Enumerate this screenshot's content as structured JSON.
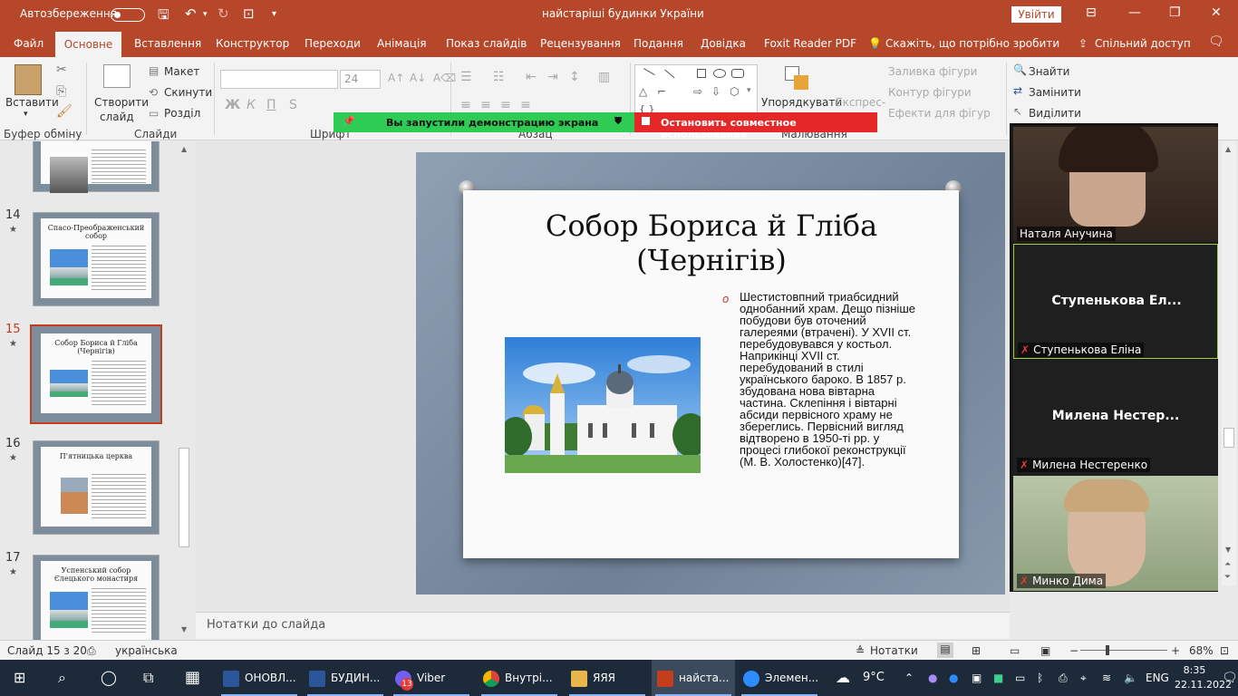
{
  "titlebar": {
    "autosave_label": "Автозбереження",
    "autosave_state": "Off",
    "doc_title": "найстаріші будинки України",
    "signin_label": "Увійти"
  },
  "tabs": [
    "Файл",
    "Основне",
    "Вставлення",
    "Конструктор",
    "Переходи",
    "Анімація",
    "Показ слайдів",
    "Рецензування",
    "Подання",
    "Довідка",
    "Foxit Reader PDF"
  ],
  "tell_me": "Скажіть, що потрібно зробити",
  "share_label": "Спільний доступ",
  "ribbon": {
    "paste": "Вставити",
    "clipboard_group": "Буфер обміну",
    "new_slide_1": "Створити",
    "new_slide_2": "слайд",
    "layout": "Макет",
    "reset": "Скинути",
    "section": "Розділ",
    "slides_group": "Слайди",
    "font_size": "24",
    "font_group": "Шрифт",
    "para_group": "Абзац",
    "arrange": "Упорядкувати",
    "express": "Експрес-",
    "shape_fill": "Заливка фігури",
    "shape_outline": "Контур фігури",
    "shape_effects": "Ефекти для фігур",
    "drawing_group": "Малювання",
    "find": "Знайти",
    "replace": "Замінити",
    "select": "Виділити",
    "bold": "Ж",
    "italic": "К",
    "underline": "П",
    "strike": "S"
  },
  "share_banner": {
    "demo_text": "Вы запустили демонстрацию экрана",
    "stop_text": "Остановить совместное использование"
  },
  "thumbnails": [
    {
      "num": "",
      "title": ""
    },
    {
      "num": "14",
      "title": "Спасо-Преображенський собор"
    },
    {
      "num": "15",
      "title": "Собор Бориса й Гліба (Чернігів)"
    },
    {
      "num": "16",
      "title": "П'ятницька церква"
    },
    {
      "num": "17",
      "title": "Успенський собор Єлецького монастиря"
    }
  ],
  "slide": {
    "title": "Собор Бориса й Гліба (Чернігів)",
    "body": "Шестистовпний триабсидний однобанний храм. Дещо пізніше побудови був оточений галереями (втрачені). У XVII ст. перебудовувався у костьол. Наприкінці XVII ст. перебудований в стилі українського бароко. В 1857 р. збудована нова вівтарна частина. Склепіння і вівтарні абсиди первісного храму не збереглись. Первісний вигляд відтворено в 1950-ті рр. у процесі глибокої реконструкції (М. В. Холостенко)[47]."
  },
  "notes_placeholder": "Нотатки до слайда",
  "participants": [
    {
      "name": "Наталя Анучина",
      "video": true,
      "muted": false
    },
    {
      "name": "Ступенькова Еліна",
      "big": "Ступенькова  Ел...",
      "video": false,
      "muted": true
    },
    {
      "name": "Милена Нестеренко",
      "big": "Милена  Нестер...",
      "video": false,
      "muted": true
    },
    {
      "name": "Минко Дима",
      "video": true,
      "muted": true
    }
  ],
  "status": {
    "slide_counter": "Слайд 15 з 20",
    "language": "українська",
    "notes_btn": "Нотатки",
    "zoom": "68%"
  },
  "taskbar": {
    "apps": [
      {
        "label": "ОНОВЛ...",
        "color": "#2b579a"
      },
      {
        "label": "БУДИН...",
        "color": "#2b579a"
      },
      {
        "label": "Viber",
        "color": "#7360f2",
        "badge": "13"
      },
      {
        "label": "Внутрі...",
        "color": "#dd4b39"
      },
      {
        "label": "ЯЯЯ",
        "color": "#e8b64a"
      },
      {
        "label": "найста...",
        "color": "#c43e1c"
      },
      {
        "label": "Элемен...",
        "color": "#2d8cff"
      }
    ],
    "weather": "9°C",
    "lang": "ENG",
    "time": "8:35",
    "date": "22.11.2022"
  }
}
